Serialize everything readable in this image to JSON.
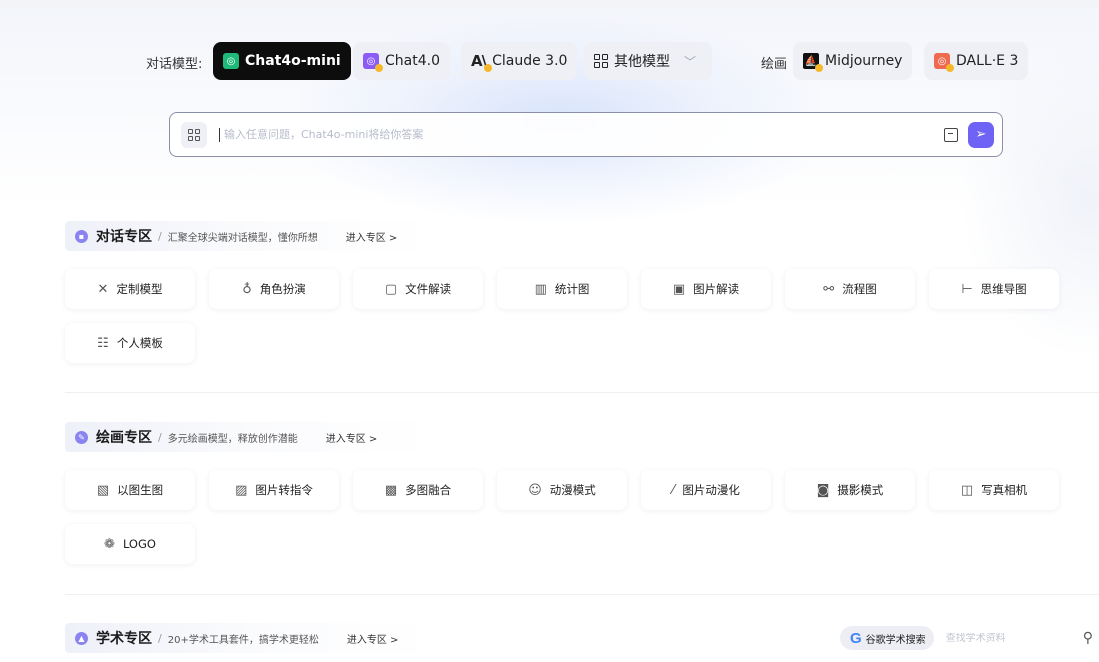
{
  "model_bar": {
    "chat_label": "对话模型:",
    "models": [
      {
        "name": "Chat4o-mini",
        "active": true
      },
      {
        "name": "Chat4.0",
        "active": false
      },
      {
        "name": "Claude 3.0",
        "active": false
      },
      {
        "name": "其他模型",
        "active": false
      }
    ],
    "draw_label": "绘画",
    "draw_models": [
      {
        "name": "Midjourney"
      },
      {
        "name": "DALL·E 3"
      }
    ]
  },
  "search": {
    "placeholder": "输入任意问题，Chat4o-mini将给你答案"
  },
  "sections": [
    {
      "title": "对话专区",
      "desc": "汇聚全球尖端对话模型，懂你所想",
      "link": "进入专区 >",
      "items": [
        "定制模型",
        "角色扮演",
        "文件解读",
        "统计图",
        "图片解读",
        "流程图",
        "思维导图",
        "个人模板"
      ]
    },
    {
      "title": "绘画专区",
      "desc": "多元绘画模型，释放创作潜能",
      "link": "进入专区 >",
      "items": [
        "以图生图",
        "图片转指令",
        "多图融合",
        "动漫模式",
        "图片动漫化",
        "摄影模式",
        "写真相机",
        "LOGO"
      ]
    },
    {
      "title": "学术专区",
      "desc": "20+学术工具套件，搞学术更轻松",
      "link": "进入专区 >"
    }
  ],
  "scholar": {
    "button_label": "谷歌学术搜索",
    "placeholder": "查找学术资料"
  }
}
